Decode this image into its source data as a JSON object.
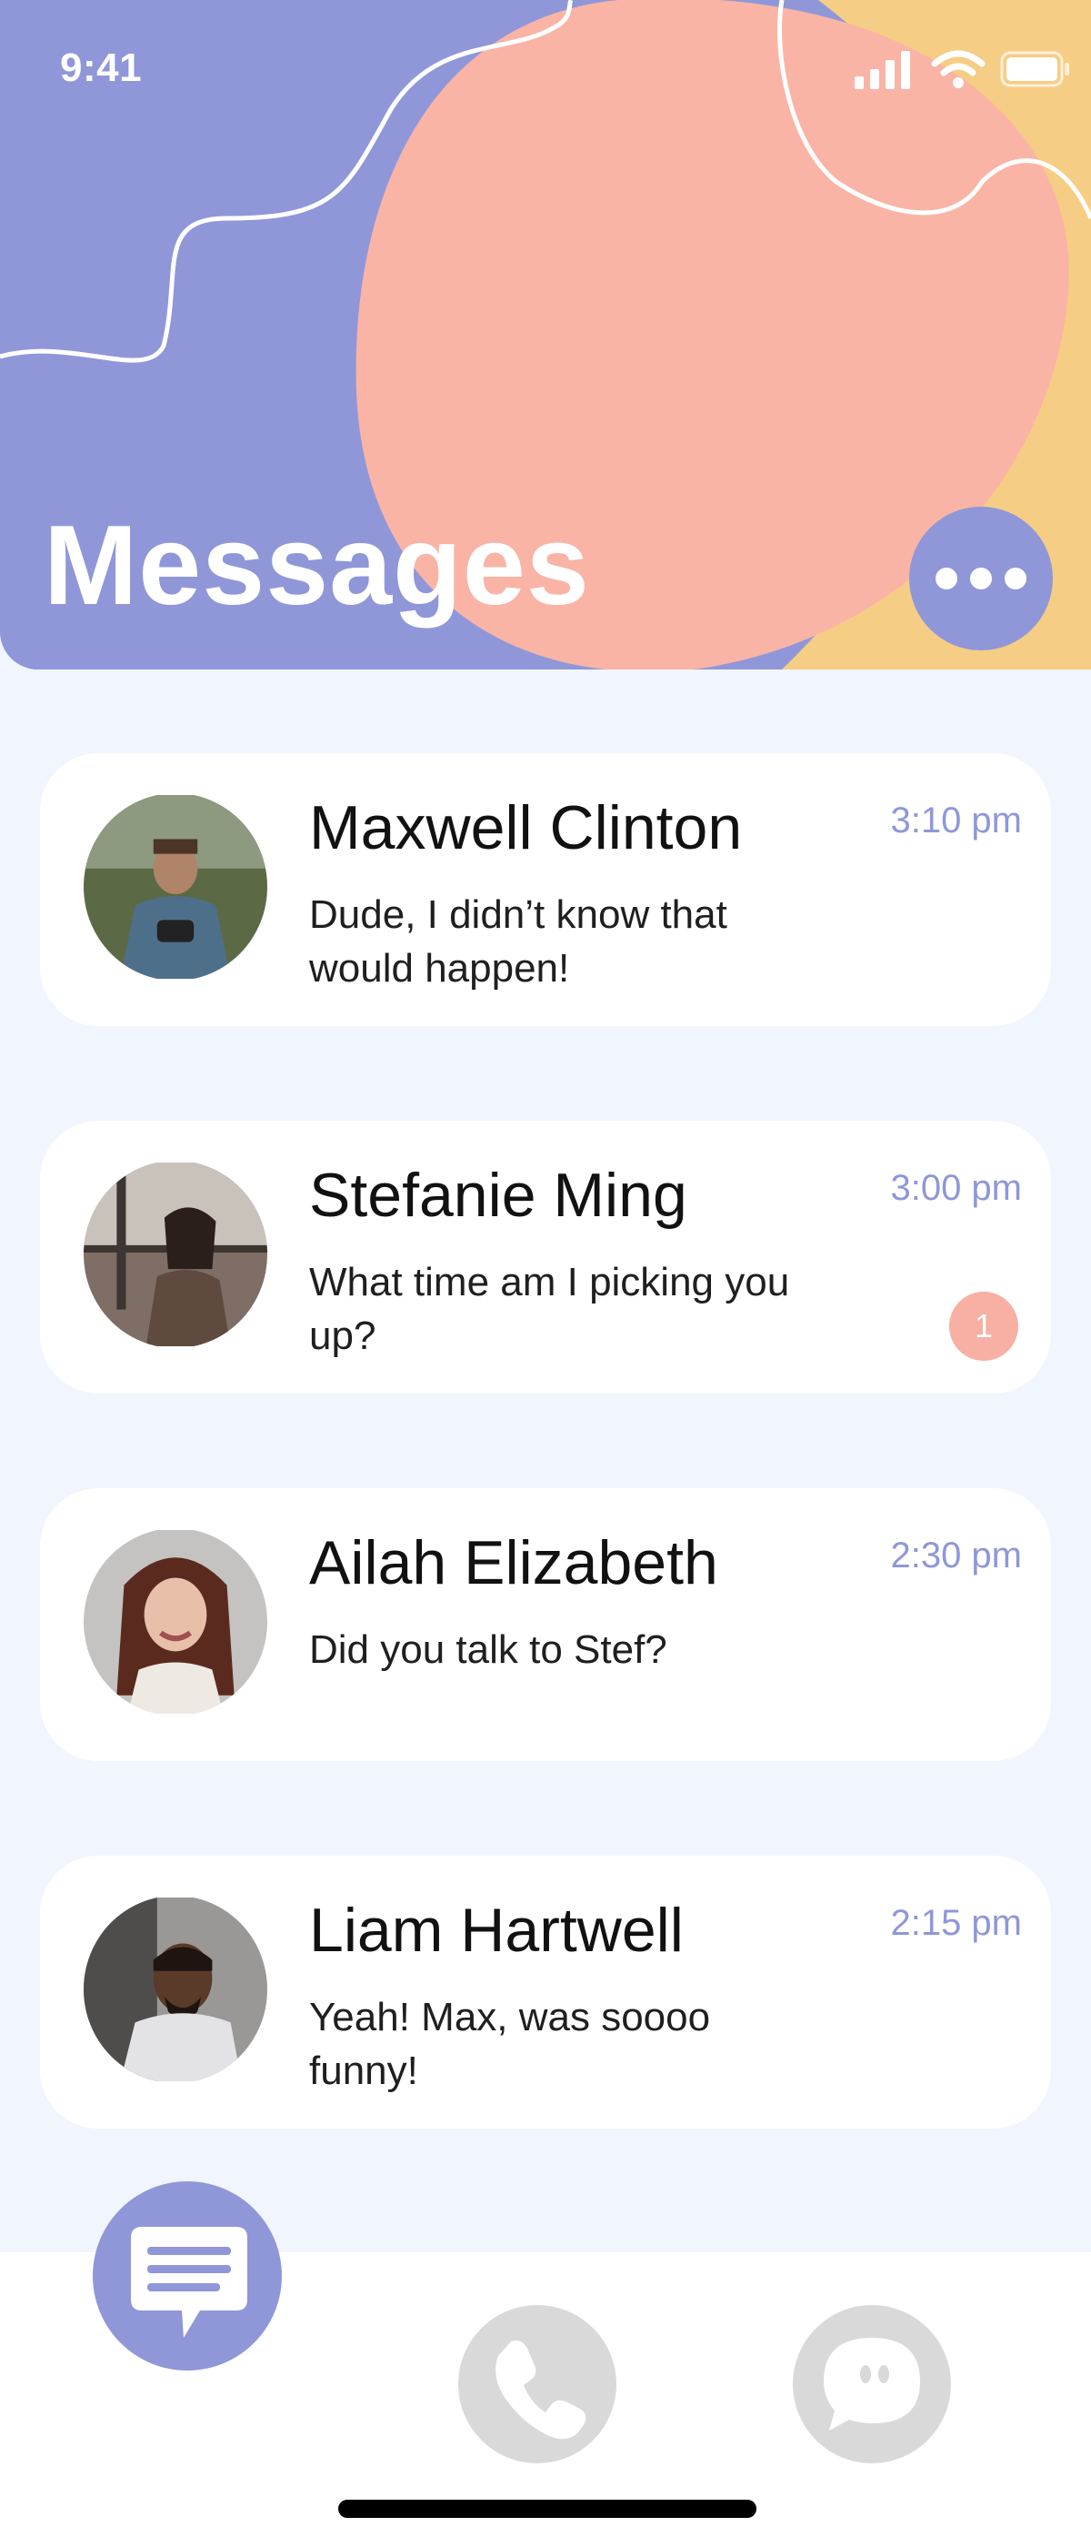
{
  "status_bar": {
    "time": "9:41"
  },
  "header": {
    "title": "Messages",
    "more_icon": "more-horizontal-icon"
  },
  "colors": {
    "header_blue": "#8f97d9",
    "salmon": "#f9b4a6",
    "yellow": "#f6cd84",
    "background": "#f1f5fe",
    "time_text": "#8f97d9",
    "badge": "#f7b0a3",
    "tab_inactive": "#d9d9d9"
  },
  "messages": [
    {
      "name": "Maxwell Clinton",
      "preview": "Dude, I didn’t know that would happen!",
      "time": "3:10 pm",
      "unread": ""
    },
    {
      "name": "Stefanie Ming",
      "preview": "What time am I picking you up?",
      "time": "3:00 pm",
      "unread": "1"
    },
    {
      "name": "Ailah Elizabeth",
      "preview": "Did you talk to Stef?",
      "time": "2:30 pm",
      "unread": ""
    },
    {
      "name": "Liam Hartwell",
      "preview": "Yeah!  Max, was soooo funny!",
      "time": "2:15 pm",
      "unread": ""
    }
  ],
  "tab_bar": {
    "tabs": [
      {
        "icon": "message-lines-icon",
        "active": true
      },
      {
        "icon": "phone-icon",
        "active": false
      },
      {
        "icon": "chat-bubble-icon",
        "active": false
      }
    ]
  }
}
